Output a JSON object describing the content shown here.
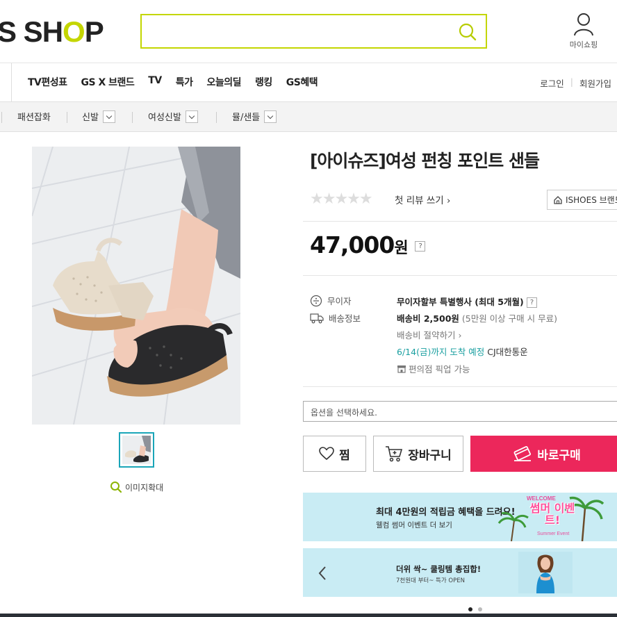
{
  "header": {
    "logo_part1": "S SH",
    "logo_o": "O",
    "logo_part2": "P",
    "search_value": "",
    "mypage_label": "마이쇼핑"
  },
  "gnb": {
    "items": [
      "TV편성표",
      "GS X 브랜드",
      "TV",
      "특가",
      "오늘의딜",
      "랭킹",
      "GS혜택"
    ],
    "login": "로그인",
    "join": "회원가입"
  },
  "category": {
    "items": [
      "패션잡화",
      "신발",
      "여성신발",
      "뮬/샌들"
    ]
  },
  "product": {
    "title": "[아이슈즈]여성 펀칭 포인트 샌들",
    "stars": "★★★★★",
    "review_link": "첫 리뷰 쓰기 ›",
    "brand_button": "ISHOES 브랜드",
    "price": "47,000",
    "price_unit": "원",
    "help_mark": "?"
  },
  "details": {
    "installment_label": "무이자",
    "installment_value": "무이자할부 특별행사 (최대 5개월)",
    "shipping_label": "배송정보",
    "shipping_fee": "배송비 2,500원",
    "shipping_note": "(5만원 이상 구매 시 무료)",
    "shipping_save": "배송비 절약하기 ›",
    "arrival": "6/14(금)까지 도착 예정",
    "courier": "CJ대한통운",
    "pickup": "편의점 픽업 가능"
  },
  "option_placeholder": "옵션을 선택하세요.",
  "buttons": {
    "zzim": "찜",
    "cart": "장바구니",
    "buy": "바로구매"
  },
  "zoom_label": "이미지확대",
  "banner1": {
    "title": "최대 4만원의 적립금 혜택을 드려요!",
    "sub": "웰컴 썸머 이벤트 더 보기",
    "badge_top": "WELCOME",
    "badge_main": "썸머 이벤트!",
    "badge_sub": "Summer Event"
  },
  "banner2": {
    "title": "더위 싹~ 쿨링템 총집합!",
    "sub": "7천원대 부터~ 특가 OPEN"
  },
  "colors": {
    "accent_green": "#c3d600",
    "buy_pink": "#ec275b",
    "teal": "#1a9fa0",
    "banner_bg": "#c9ecf4"
  }
}
